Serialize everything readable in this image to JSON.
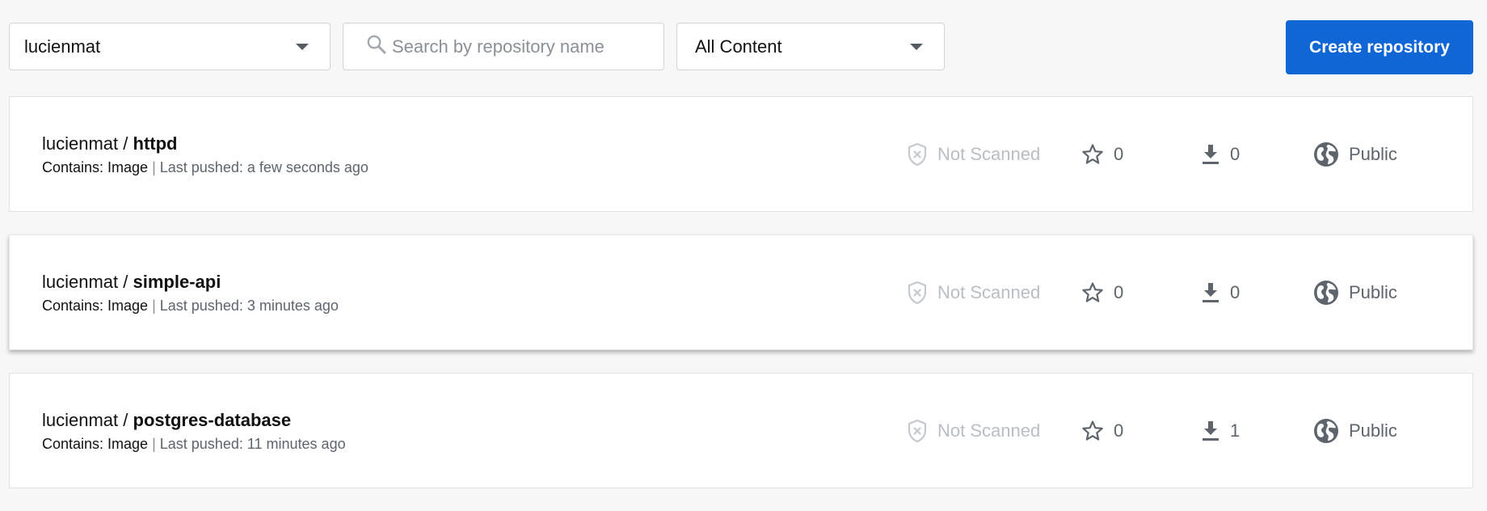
{
  "toolbar": {
    "namespace_value": "lucienmat",
    "search_placeholder": "Search by repository name",
    "filter_value": "All Content",
    "create_label": "Create repository"
  },
  "repositories": [
    {
      "namespace": "lucienmat",
      "separator": " / ",
      "name": "httpd",
      "contains": "Contains: Image",
      "meta_separator": " | ",
      "last_pushed": "Last pushed: a few seconds ago",
      "scan_status": "Not Scanned",
      "stars": "0",
      "pulls": "0",
      "visibility": "Public"
    },
    {
      "namespace": "lucienmat",
      "separator": " / ",
      "name": "simple-api",
      "contains": "Contains: Image",
      "meta_separator": " | ",
      "last_pushed": "Last pushed: 3 minutes ago",
      "scan_status": "Not Scanned",
      "stars": "0",
      "pulls": "0",
      "visibility": "Public"
    },
    {
      "namespace": "lucienmat",
      "separator": " / ",
      "name": "postgres-database",
      "contains": "Contains: Image",
      "meta_separator": " | ",
      "last_pushed": "Last pushed: 11 minutes ago",
      "scan_status": "Not Scanned",
      "stars": "0",
      "pulls": "1",
      "visibility": "Public"
    }
  ],
  "icons": {
    "namespace_dropdown": "caret-down-icon",
    "search": "search-icon",
    "filter_dropdown": "caret-down-icon",
    "scan": "shield-x-icon",
    "stars": "star-icon",
    "pulls": "download-icon",
    "visibility": "globe-icon"
  },
  "colors": {
    "page_background": "#f7f7f7",
    "primary_button": "#1166d6",
    "row_background": "#ffffff",
    "muted_text": "#b9bec4",
    "secondary_text": "#5d646c"
  }
}
